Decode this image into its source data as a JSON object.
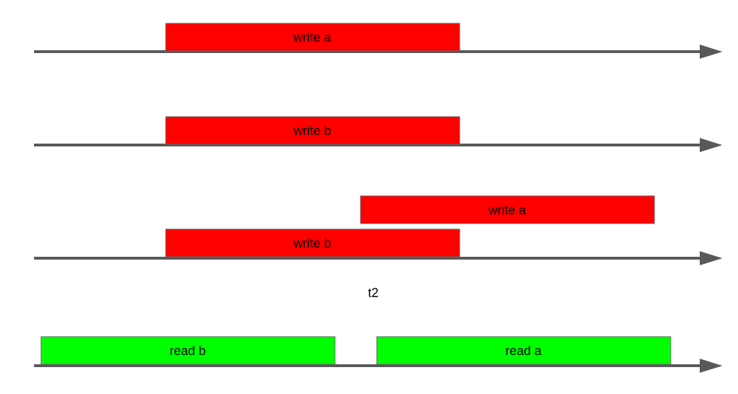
{
  "timelines": [
    {
      "bars": [
        {
          "label": "write a",
          "kind": "write"
        }
      ]
    },
    {
      "bars": [
        {
          "label": "write b",
          "kind": "write"
        }
      ]
    },
    {
      "bars": [
        {
          "label": "write a",
          "kind": "write"
        },
        {
          "label": "write b",
          "kind": "write"
        }
      ]
    },
    {
      "bars": [
        {
          "label": "read b",
          "kind": "read"
        },
        {
          "label": "read a",
          "kind": "read"
        }
      ]
    }
  ],
  "time_label": "t2"
}
